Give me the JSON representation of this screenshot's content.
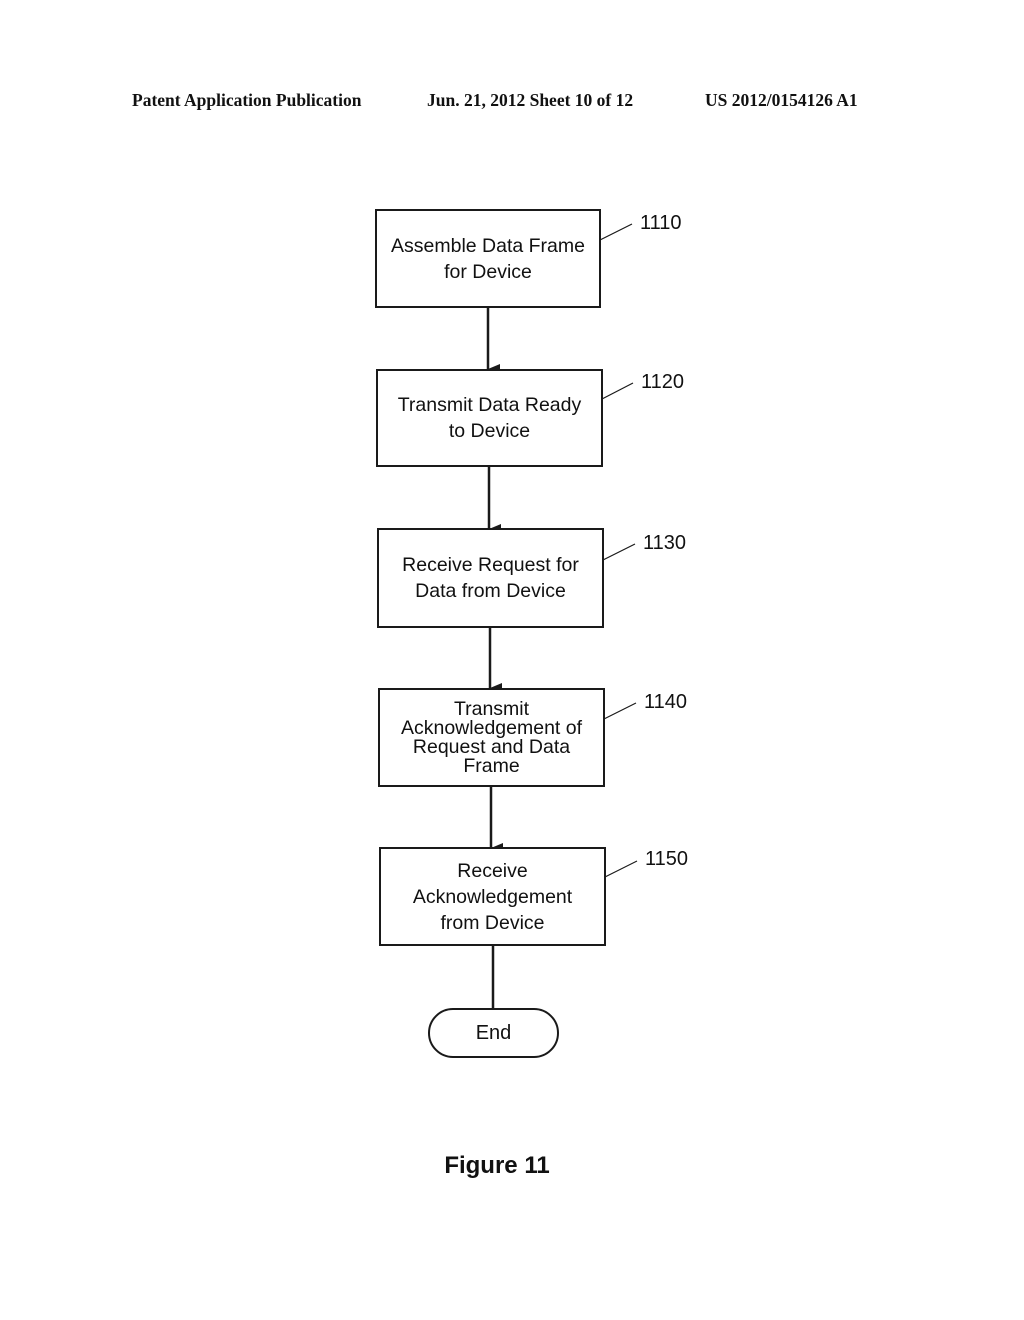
{
  "header": {
    "publication": "Patent Application Publication",
    "date_sheet": "Jun. 21, 2012  Sheet 10 of 12",
    "patent_number": "US 2012/0154126 A1"
  },
  "flowchart": {
    "steps": [
      {
        "ref": "1110",
        "text": "Assemble Data Frame\nfor Device"
      },
      {
        "ref": "1120",
        "text": "Transmit Data Ready\nto Device"
      },
      {
        "ref": "1130",
        "text": "Receive Request for\nData from Device"
      },
      {
        "ref": "1140",
        "text": "Transmit\nAcknowledgement of\nRequest and Data\nFrame"
      },
      {
        "ref": "1150",
        "text": "Receive\nAcknowledgement\nfrom Device"
      }
    ],
    "terminal": "End"
  },
  "caption": "Figure 11"
}
